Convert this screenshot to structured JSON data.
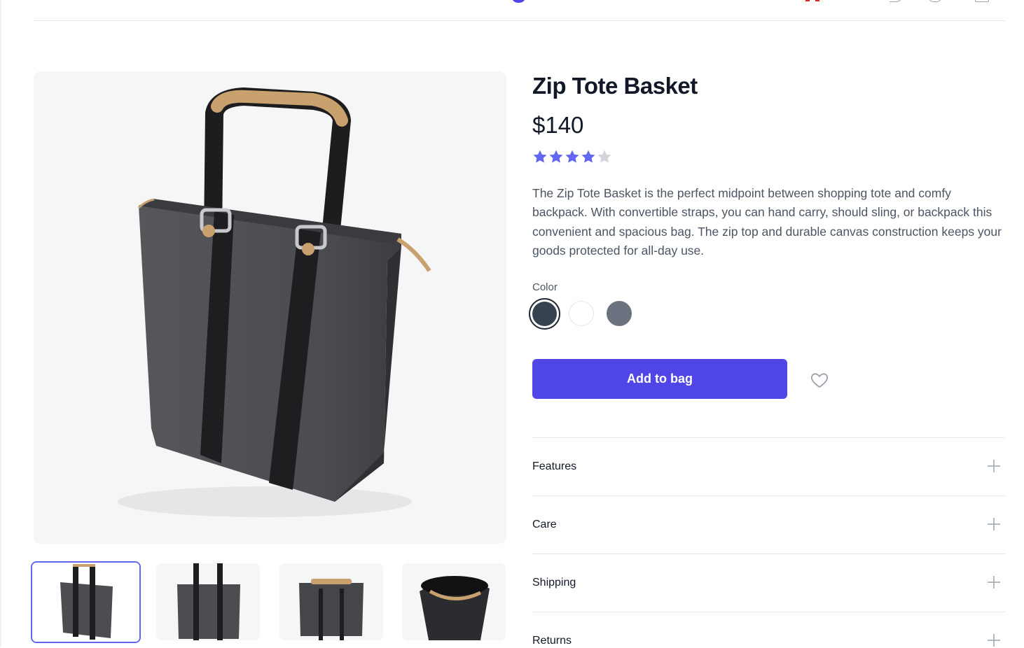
{
  "product": {
    "title": "Zip Tote Basket",
    "price": "$140",
    "rating": 4,
    "rating_max": 5,
    "description": "The Zip Tote Basket is the perfect midpoint between shopping tote and comfy backpack. With convertible straps, you can hand carry, should sling, or backpack this convenient and spacious bag. The zip top and durable canvas construction keeps your goods protected for all-day use."
  },
  "colors": {
    "label": "Color",
    "options": [
      {
        "name": "washed-black",
        "hex": "#374151",
        "selected": true
      },
      {
        "name": "white",
        "hex": "#ffffff",
        "selected": false
      },
      {
        "name": "washed-gray",
        "hex": "#6b7280",
        "selected": false
      }
    ]
  },
  "actions": {
    "add_to_bag_label": "Add to bag",
    "favorite_icon": "heart-icon"
  },
  "accordion": [
    {
      "label": "Features",
      "icon": "plus-icon"
    },
    {
      "label": "Care",
      "icon": "plus-icon"
    },
    {
      "label": "Shipping",
      "icon": "plus-icon"
    },
    {
      "label": "Returns",
      "icon": "plus-icon"
    }
  ],
  "theme": {
    "accent": "#4f46e5",
    "star_filled": "#6366f1",
    "star_empty": "#d1d5db",
    "text_primary": "#111827",
    "text_secondary": "#4b5563"
  }
}
